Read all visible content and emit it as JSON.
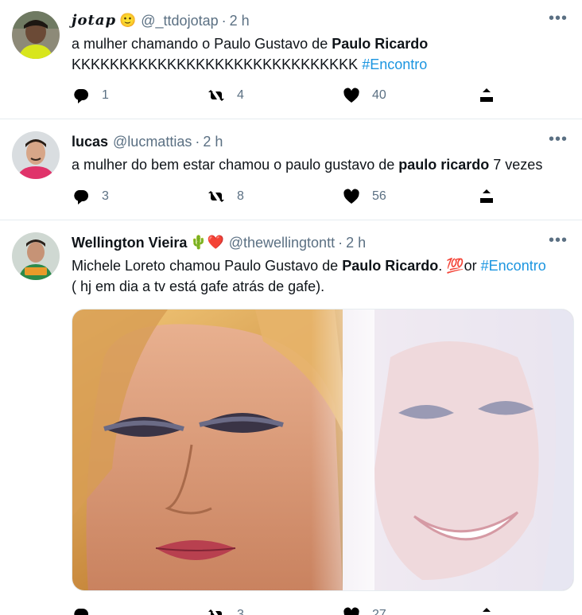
{
  "tweets": [
    {
      "name": "jotap",
      "name_emoji": "🙂",
      "handle": "@_ttdojotap",
      "separator": "·",
      "time": "2 h",
      "text_1": "a mulher chamando o Paulo Gustavo de ",
      "text_bold": "Paulo Ricardo",
      "text_2": "KKKKKKKKKKKKKKKKKKKKKKKKKKKKKK ",
      "hashtag": "#Encontro",
      "replies": "1",
      "retweets": "4",
      "likes": "40"
    },
    {
      "name": "lucas",
      "handle": "@lucmattias",
      "separator": "·",
      "time": "2 h",
      "text_1": "a mulher do bem estar chamou o paulo gustavo de ",
      "text_bold": "paulo ricardo",
      "text_2": " 7 vezes",
      "replies": "3",
      "retweets": "8",
      "likes": "56"
    },
    {
      "name": "Wellington Vieira",
      "name_emoji": "🌵❤️",
      "handle": "@thewellingtontt",
      "separator": "·",
      "time": "2 h",
      "text_1": "Michele Loreto chamou Paulo Gustavo de ",
      "text_bold": "Paulo Ricardo",
      "text_2": ". 💯or  ",
      "hashtag": "#Encontro",
      "text_3": "( hj em dia a tv está gafe atrás de gafe).",
      "retweets": "3",
      "likes": "27"
    }
  ],
  "icons": {
    "more": "more-icon",
    "reply": "reply-icon",
    "retweet": "retweet-icon",
    "like": "heart-icon",
    "share": "share-icon"
  },
  "colors": {
    "hashtag": "#1b95e0",
    "secondary_text": "#5b7083",
    "divider": "#e6ecf0"
  }
}
